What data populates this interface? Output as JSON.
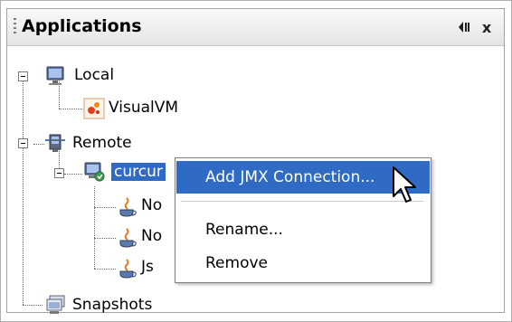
{
  "panel": {
    "title": "Applications",
    "minimize_icon": "minimize-icon",
    "close_label": "x"
  },
  "tree": {
    "local": {
      "label": "Local",
      "icon": "computer-icon"
    },
    "visualvm": {
      "label": "VisualVM",
      "icon": "visualvm-icon"
    },
    "remote": {
      "label": "Remote",
      "icon": "remote-hosts-icon"
    },
    "host": {
      "label": "curcur",
      "icon": "remote-host-icon"
    },
    "children": [
      {
        "label": "No",
        "icon": "java-app-icon"
      },
      {
        "label": "No",
        "icon": "java-app-icon"
      },
      {
        "label": "Js",
        "icon": "java-app-icon"
      }
    ],
    "snapshots": {
      "label": "Snapshots",
      "icon": "snapshots-icon"
    }
  },
  "context_menu": {
    "items": [
      {
        "label": "Add JMX Connection..."
      },
      {
        "label": "Rename..."
      },
      {
        "label": "Remove"
      }
    ]
  },
  "colors": {
    "selection": "#2f6bc4",
    "java_orange": "#e07a1f"
  }
}
